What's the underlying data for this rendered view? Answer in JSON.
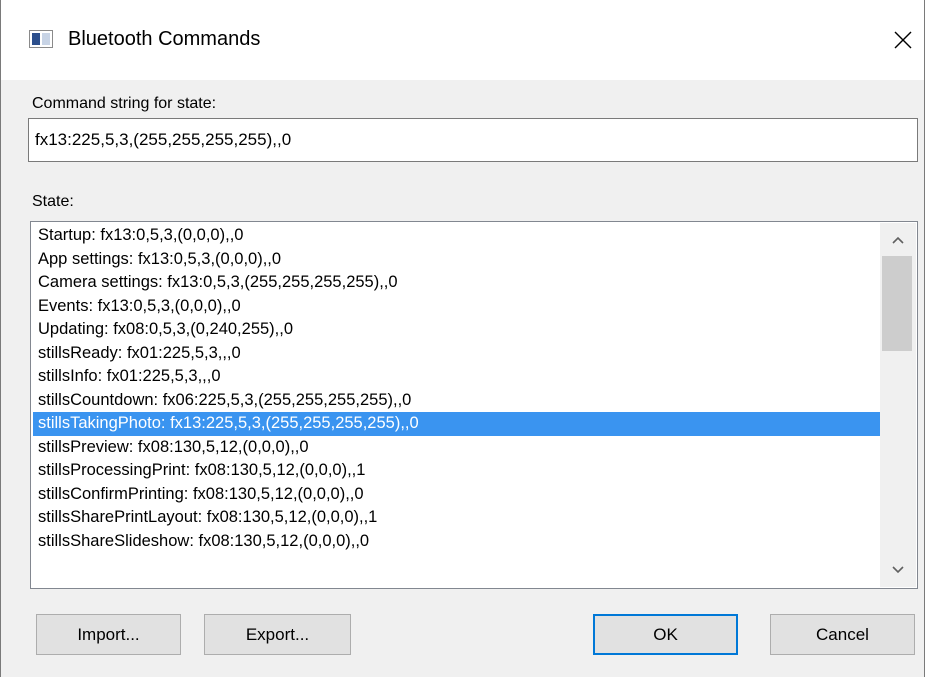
{
  "window": {
    "title": "Bluetooth Commands"
  },
  "command": {
    "label": "Command string for state:",
    "value": "fx13:225,5,3,(255,255,255,255),,0"
  },
  "states": {
    "label": "State:",
    "selected_index": 8,
    "items": [
      "Startup: fx13:0,5,3,(0,0,0),,0",
      "App settings: fx13:0,5,3,(0,0,0),,0",
      "Camera settings: fx13:0,5,3,(255,255,255,255),,0",
      "Events: fx13:0,5,3,(0,0,0),,0",
      "Updating: fx08:0,5,3,(0,240,255),,0",
      "stillsReady: fx01:225,5,3,,,0",
      "stillsInfo: fx01:225,5,3,,,0",
      "stillsCountdown: fx06:225,5,3,(255,255,255,255),,0",
      "stillsTakingPhoto: fx13:225,5,3,(255,255,255,255),,0",
      "stillsPreview: fx08:130,5,12,(0,0,0),,0",
      "stillsProcessingPrint: fx08:130,5,12,(0,0,0),,1",
      "stillsConfirmPrinting: fx08:130,5,12,(0,0,0),,0",
      "stillsSharePrintLayout: fx08:130,5,12,(0,0,0),,1",
      "stillsShareSlideshow: fx08:130,5,12,(0,0,0),,0"
    ]
  },
  "buttons": {
    "import": "Import...",
    "export": "Export...",
    "ok": "OK",
    "cancel": "Cancel"
  },
  "icons": {
    "app": "app-window-icon",
    "close": "close-icon",
    "scroll_up": "chevron-up-icon",
    "scroll_down": "chevron-down-icon"
  },
  "colors": {
    "selection": "#3a94f0",
    "default_button_border": "#0078d7",
    "dialog_background": "#f0f0f0"
  }
}
